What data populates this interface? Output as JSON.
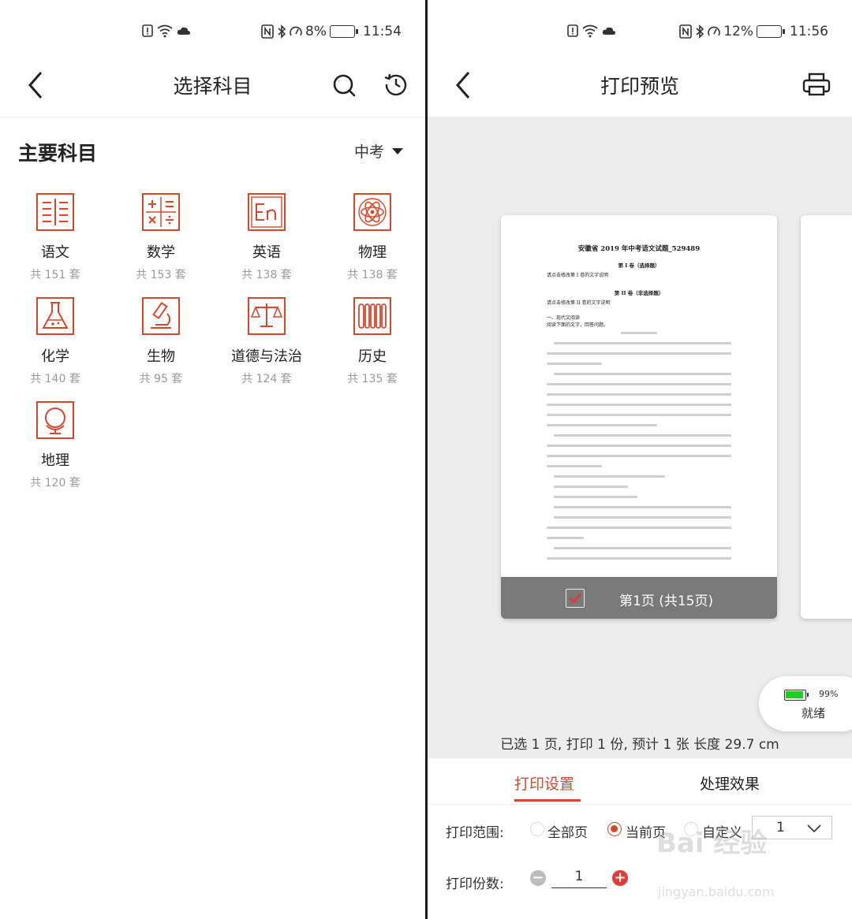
{
  "left": {
    "status": {
      "time": "11:54",
      "battery": "8%"
    },
    "title": "选择科目",
    "section_title": "主要科目",
    "exam_type": "中考",
    "subjects": [
      {
        "name": "语文",
        "count": "共 151 套",
        "icon": "book-columns-icon"
      },
      {
        "name": "数学",
        "count": "共 153 套",
        "icon": "math-operators-icon"
      },
      {
        "name": "英语",
        "count": "共 138 套",
        "icon": "en-letters-icon"
      },
      {
        "name": "物理",
        "count": "共 138 套",
        "icon": "atom-icon"
      },
      {
        "name": "化学",
        "count": "共 140 套",
        "icon": "flask-icon"
      },
      {
        "name": "生物",
        "count": "共 95 套",
        "icon": "microscope-icon"
      },
      {
        "name": "道德与法治",
        "count": "共 124 套",
        "icon": "scales-icon"
      },
      {
        "name": "历史",
        "count": "共 135 套",
        "icon": "scroll-icon"
      },
      {
        "name": "地理",
        "count": "共 120 套",
        "icon": "globe-icon"
      }
    ]
  },
  "right": {
    "status": {
      "time": "11:56",
      "battery": "12%"
    },
    "title": "打印预览",
    "doc": {
      "title": "安徽省 2019 年中考语文试题_529489",
      "part1": "第 I 卷（选择题）",
      "part1_note": "请点击修改第 I 卷的文字说明",
      "part2": "第 II 卷（非选择题）",
      "part2_note": "请点击修改第 II 卷的文字说明",
      "section": "一、现代文阅读",
      "instruction": "阅读下面的文字，回答问题。"
    },
    "page_label": "第1页 (共15页)",
    "device": {
      "battery": "99%",
      "status": "就绪"
    },
    "summary": "已选 1 页, 打印 1 份, 预计 1 张 长度 29.7 cm",
    "tabs": [
      {
        "label": "打印设置"
      },
      {
        "label": "处理效果"
      }
    ],
    "range": {
      "label": "打印范围:",
      "options": [
        {
          "label": "全部页"
        },
        {
          "label": "当前页"
        },
        {
          "label": "自定义"
        }
      ],
      "custom_value": "1"
    },
    "copies": {
      "label": "打印份数:",
      "value": "1"
    },
    "watermark": "Bai 经验",
    "watermark_sub": "jingyan.baidu.com"
  }
}
